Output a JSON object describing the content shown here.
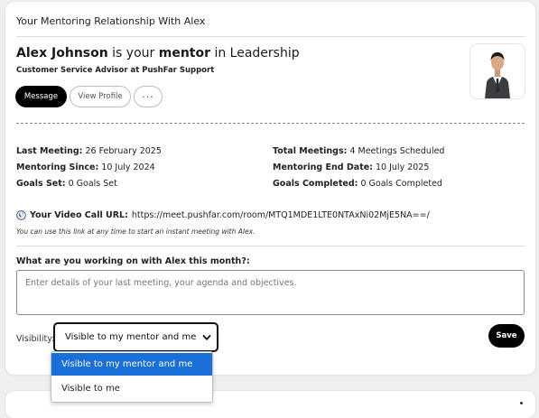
{
  "section": {
    "title": "Your Mentoring Relationship With Alex"
  },
  "mentor": {
    "name": "Alex Johnson",
    "mid_text": " is your ",
    "role": "mentor",
    "area_prefix": " in ",
    "area": "Leadership",
    "subtitle": "Customer Service Advisor at PushFar Support",
    "avatar_icon": "person-avatar"
  },
  "actions": {
    "message": "Message",
    "view_profile": "View Profile",
    "more": "···"
  },
  "stats": {
    "last_meeting_label": "Last Meeting:",
    "last_meeting_value": " 26 February 2025",
    "mentoring_since_label": "Mentoring Since:",
    "mentoring_since_value": " 10 July 2024",
    "goals_set_label": "Goals Set:",
    "goals_set_value": " 0 Goals Set",
    "total_meetings_label": "Total Meetings:",
    "total_meetings_value": " 4 Meetings Scheduled",
    "end_date_label": "Mentoring End Date:",
    "end_date_value": " 10 July 2025",
    "goals_completed_label": "Goals Completed:",
    "goals_completed_value": " 0 Goals Completed"
  },
  "video": {
    "icon": "globe-icon",
    "label": "Your Video Call URL:",
    "url": " https://meet.pushfar.com/room/MTQ1MDE1LTE0NTAxNi02MjE5NA==/",
    "note": "You can use this link at any time to start an instant meeting with Alex."
  },
  "working_on": {
    "label": "What are you working on with Alex this month?:",
    "placeholder": "Enter details of your last meeting, your agenda and objectives."
  },
  "visibility": {
    "label": "Visibility:",
    "selected": "Visible to my mentor and me",
    "options": [
      "Visible to my mentor and me",
      "Visible to me"
    ]
  },
  "save_label": "Save",
  "colors": {
    "primary_button": "#000000",
    "dropdown_highlight": "#1a6fd9",
    "background": "#efefef"
  }
}
